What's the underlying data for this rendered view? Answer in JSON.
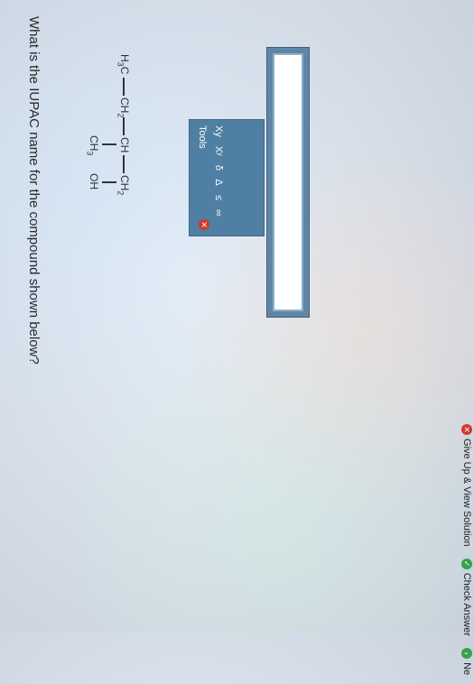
{
  "question": {
    "text": "What is the IUPAC name for the compound shown below?"
  },
  "structure": {
    "groups": [
      "H3C",
      "CH2",
      "CH",
      "CH2"
    ],
    "substituents": [
      "CH3",
      "OH"
    ]
  },
  "answer": {
    "value": "",
    "placeholder": ""
  },
  "tools": {
    "title": "Tools",
    "buttons": [
      "Xy",
      "Xʸ",
      "δ",
      "Δ",
      "≤",
      "∞"
    ]
  },
  "actions": {
    "give_up": "Give Up & View Solution",
    "check": "Check Answer",
    "next": "Ne"
  },
  "colors": {
    "panel": "#5f86a6",
    "give_up_icon": "#d23a2a",
    "check_icon": "#3aa14a"
  }
}
